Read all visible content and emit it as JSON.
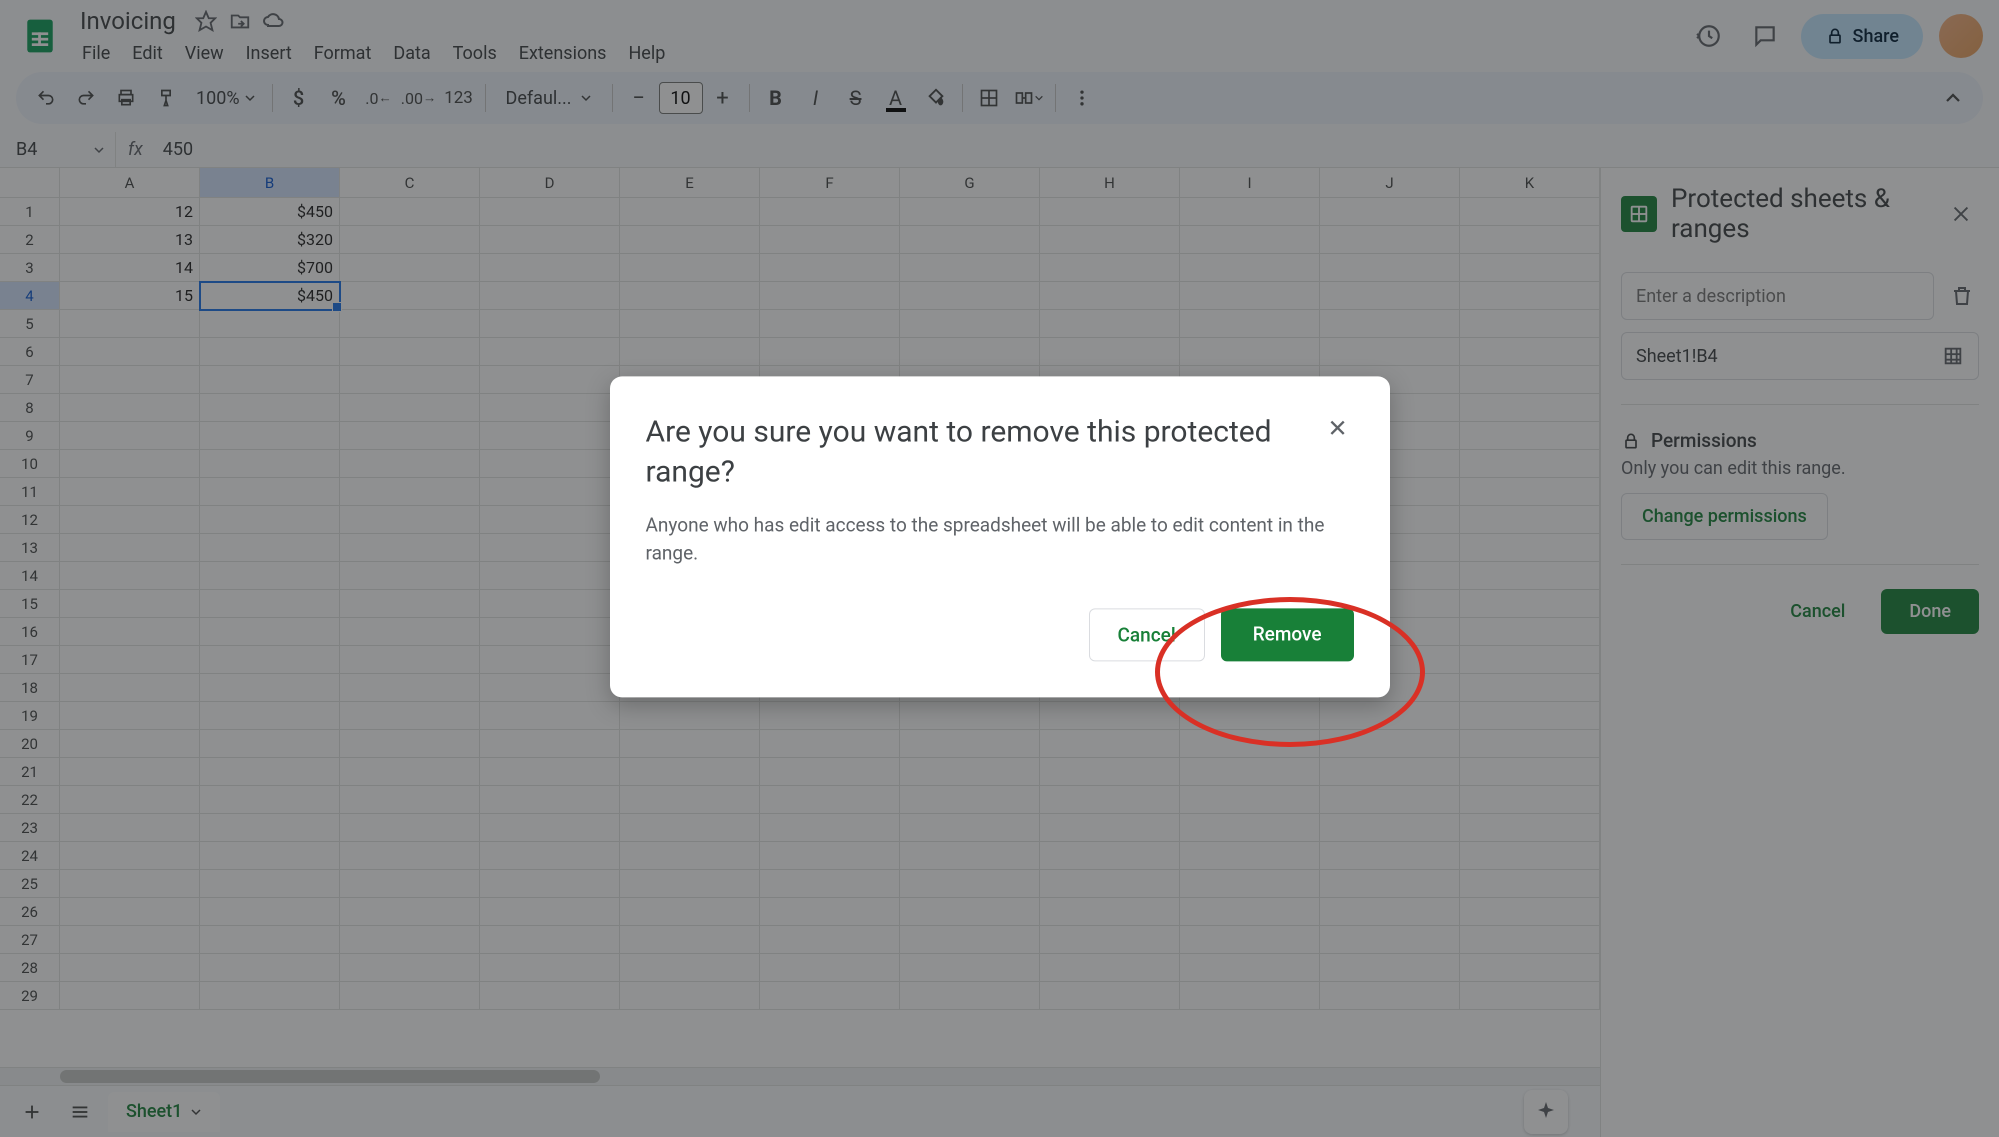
{
  "doc_title": "Invoicing",
  "menu": [
    "File",
    "Edit",
    "View",
    "Insert",
    "Format",
    "Data",
    "Tools",
    "Extensions",
    "Help"
  ],
  "share_label": "Share",
  "toolbar": {
    "zoom": "100%",
    "fmt123": "123",
    "font_name": "Defaul...",
    "font_size": "10"
  },
  "name_box": "B4",
  "formula_value": "450",
  "columns": [
    "A",
    "B",
    "C",
    "D",
    "E",
    "F",
    "G",
    "H",
    "I",
    "J",
    "K"
  ],
  "row_count": 29,
  "selected_col_idx": 1,
  "selected_row_idx": 3,
  "cells": {
    "A1": "12",
    "B1": "$450",
    "A2": "13",
    "B2": "$320",
    "A3": "14",
    "B3": "$700",
    "A4": "15",
    "B4": "$450"
  },
  "tab_name": "Sheet1",
  "side_panel": {
    "title": "Protected sheets & ranges",
    "desc_placeholder": "Enter a description",
    "range": "Sheet1!B4",
    "perm_title": "Permissions",
    "perm_sub": "Only you can edit this range.",
    "change_btn": "Change permissions",
    "cancel": "Cancel",
    "done": "Done"
  },
  "modal": {
    "title": "Are you sure you want to remove this protected range?",
    "body": "Anyone who has edit access to the spreadsheet will be able to edit content in the range.",
    "cancel": "Cancel",
    "remove": "Remove"
  }
}
